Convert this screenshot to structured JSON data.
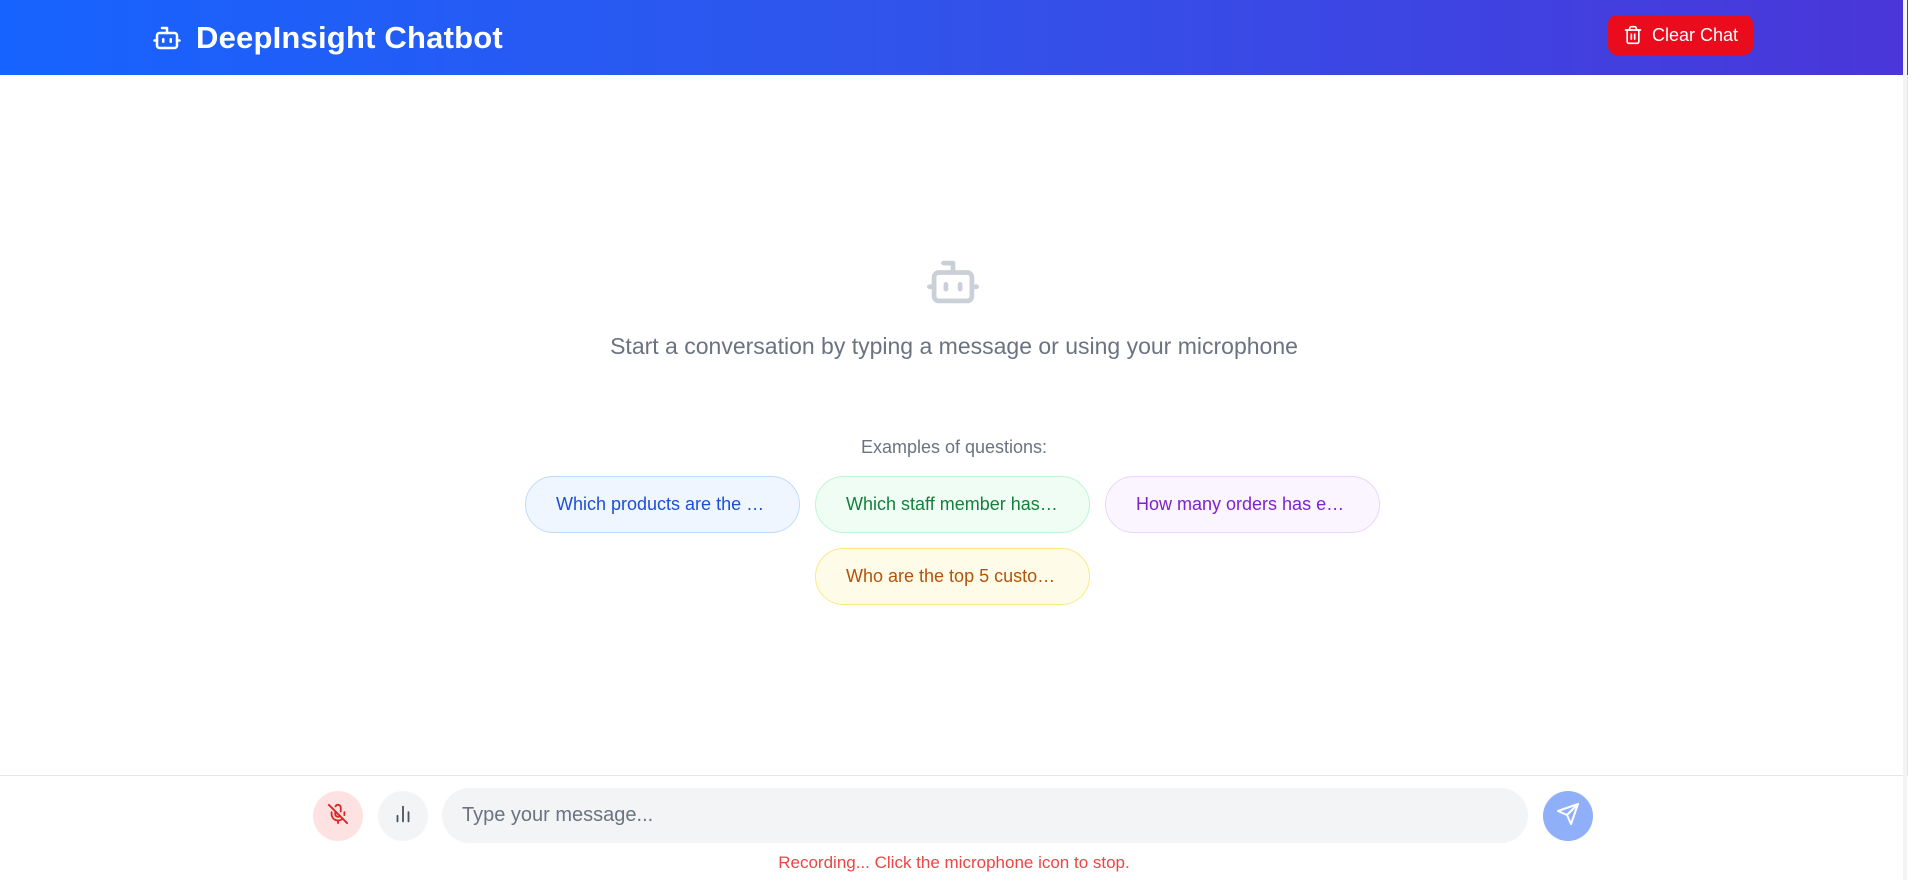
{
  "header": {
    "title": "DeepInsight Chatbot",
    "title_icon": "robot-icon",
    "clear_label": "Clear Chat",
    "clear_icon": "trash-icon"
  },
  "empty_state": {
    "icon": "robot-icon",
    "message": "Start a conversation by typing a message or using your microphone",
    "examples_label": "Examples of questions:",
    "examples": [
      {
        "text": "Which products are the …",
        "color": "#1d4ed8"
      },
      {
        "text": "Which staff member has …",
        "color": "#15803d"
      },
      {
        "text": "How many orders has ea…",
        "color": "#7e22ce"
      },
      {
        "text": "Who are the top 5 custo…",
        "color": "#b45309"
      }
    ]
  },
  "input_bar": {
    "mic_icon": "mic-off-icon",
    "visualizer_icon": "bar-chart-icon",
    "placeholder": "Type your message...",
    "value": "",
    "send_icon": "send-icon",
    "status_text": "Recording... Click the microphone icon to stop."
  },
  "colors": {
    "header_gradient_start": "#1763ff",
    "header_gradient_end": "#4a36d9",
    "danger": "#ea0b1c",
    "send_button": "#8fb0f9"
  }
}
